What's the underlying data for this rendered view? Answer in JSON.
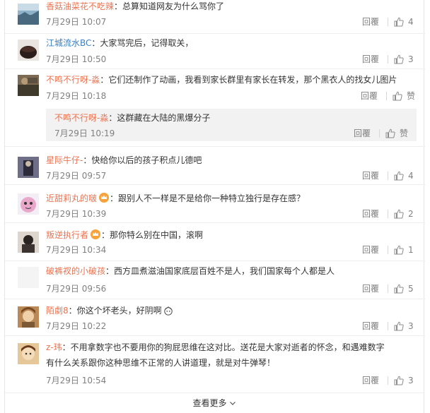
{
  "reply_label": "回覆",
  "comments": [
    {
      "user": "香菇油菜花不吃辣",
      "text": "总算知道网友为什么骂你了",
      "time": "7月29日 10:07",
      "likes": "4"
    },
    {
      "user": "江城流水BC",
      "text": "大家骂完后，记得取关，",
      "time": "7月29日 10:50",
      "likes": "3"
    },
    {
      "user": "不鸣不行呀-淼",
      "text": "它们还制作了动画，我看到家长群里有家长在转发，那个黑衣人的找女儿图片",
      "time": "7月29日 10:18",
      "likes": "赞"
    },
    {
      "user": "星际牛仔-",
      "text": "快给你以后的孩子积点儿德吧",
      "time": "7月29日 09:57",
      "likes": "4"
    },
    {
      "user": "近甜莉丸的啵",
      "text": "跟别人不一样是不是给你一种特立独行是存在感？",
      "time": "7月29日 10:39",
      "likes": "2"
    },
    {
      "user": "叛逆执行者",
      "text": "那你特么别在中国，滚啊",
      "time": "7月29日 10:34",
      "likes": "1"
    },
    {
      "user": "破裤衩的小破孩",
      "text": "西方皿煮滋油国家底层百姓不是人，我们国家每个人都是人",
      "time": "7月29日 09:56",
      "likes": "5"
    },
    {
      "user": "陌劇8",
      "text": "你这个坏老头，好阴啊",
      "time": "7月29日 10:22",
      "likes": "3"
    },
    {
      "user": "z-玮",
      "text": "不用拿数字也不要用你的狗屁思维在这对比。送花是大家对逝者的怀念，和遇难数字有什么关系跟你这种思维不正常的人讲道理，就是对牛弹琴！",
      "time": "7月29日 10:54",
      "likes": "3"
    }
  ],
  "nested_reply": {
    "user": "不鸣不行呀-淼",
    "text": "这群藏在大陆的黑爆分子",
    "time": "7月29日 10:19",
    "likes": "赞"
  },
  "more_label": "查看更多",
  "colors": {
    "username": "#eb7350",
    "username_alt": "#3a7fc2",
    "meta": "#808080"
  },
  "icons": [
    "thumbs-up-icon",
    "crown-badge-icon",
    "chevron-down-icon",
    "emoji-icon"
  ]
}
